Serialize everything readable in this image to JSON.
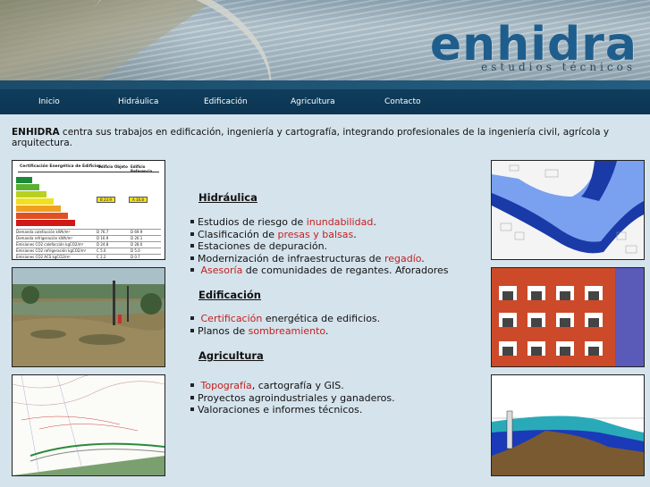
{
  "header": {
    "logo_text": "enhidra",
    "logo_subtitle": "estudios técnicos"
  },
  "nav": {
    "items": [
      {
        "label": "Inicio"
      },
      {
        "label": "Hidráulica"
      },
      {
        "label": "Edificación"
      },
      {
        "label": "Agricultura"
      },
      {
        "label": "Contacto"
      }
    ]
  },
  "intro": {
    "brand": "ENHIDRA",
    "text": " centra sus trabajos en edificación, ingeniería y cartografía, integrando profesionales de la ingeniería civil, agrícola y arquitectura."
  },
  "sections": {
    "hidraulica": {
      "title": "Hidráulica",
      "items": [
        {
          "pre": "Estudios de riesgo de ",
          "link": "inundabilidad",
          "post": "."
        },
        {
          "pre": "Clasificación de ",
          "link": "presas y balsas",
          "post": "."
        },
        {
          "pre": "Estaciones de depuración.",
          "link": "",
          "post": ""
        },
        {
          "pre": "Modernización de infraestructuras de ",
          "link": "regadío",
          "post": "."
        },
        {
          "pre": " ",
          "link": "Asesoría",
          "post": " de comunidades de regantes. Aforadores"
        }
      ]
    },
    "edificacion": {
      "title": "Edificación",
      "items": [
        {
          "pre": " ",
          "link": "Certificación",
          "post": " energética de edificios."
        },
        {
          "pre": "Planos de ",
          "link": "sombreamiento",
          "post": "."
        }
      ]
    },
    "agricultura": {
      "title": "Agricultura",
      "items": [
        {
          "pre": " ",
          "link": "Topografía",
          "post": ", cartografía y GIS."
        },
        {
          "pre": "Proyectos agroindustriales y ganaderos.",
          "link": "",
          "post": ""
        },
        {
          "pre": "Valoraciones e informes técnicos.",
          "link": "",
          "post": ""
        }
      ]
    }
  },
  "thumbs": {
    "cert": {
      "title": "Certificación Energética de Edificios",
      "col1": "Edificio Objeto",
      "col2": "Edificio Referencia",
      "badge1": "B 23.9",
      "badge2": "A 16.8",
      "rows": [
        {
          "label": "Demanda calefacción kWh/m²",
          "v1": "D 76.7",
          "v2": "D 69.9"
        },
        {
          "label": "Demanda refrigeración kWh/m²",
          "v1": "D 16.9",
          "v2": "D 26.1"
        },
        {
          "label": "Emisiones CO2 calefacción kgCO2/m²",
          "v1": "D 24.8",
          "v2": "D 28.0"
        },
        {
          "label": "Emisiones CO2 refrigeración kgCO2/m²",
          "v1": "C 5.0",
          "v2": "D 5.0"
        },
        {
          "label": "Emisiones CO2 ACS kgCO2/m²",
          "v1": "C 2.2",
          "v2": "D 0.7"
        }
      ]
    }
  },
  "colors": {
    "nav_bg": "#0f3d5c",
    "link": "#c42020",
    "page_bg": "#d5e3ec",
    "logo_blue": "#1f5e8c",
    "logo_green": "#4a9a3a"
  }
}
